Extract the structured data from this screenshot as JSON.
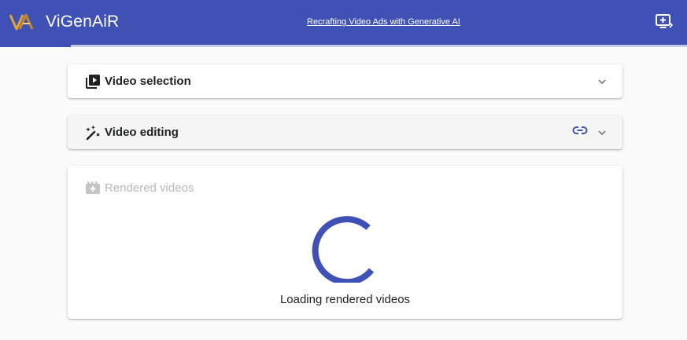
{
  "app": {
    "title": "ViGenAiR",
    "tagline": "Recrafting Video Ads with Generative AI"
  },
  "colors": {
    "primary": "#3f51b5",
    "progress_fill": "#c5cae9",
    "background": "#fafafa",
    "muted_text": "#b8b8b8"
  },
  "progress": {
    "fraction_complete": 0.1
  },
  "panels": {
    "video_selection": {
      "title": "Video selection",
      "icon": "video-library-icon",
      "expanded": false
    },
    "video_editing": {
      "title": "Video editing",
      "icon": "magic-wand-icon",
      "extra_icon": "link-icon",
      "expanded": false
    },
    "rendered_videos": {
      "title": "Rendered videos",
      "icon": "movie-edit-icon",
      "loading_text": "Loading rendered videos"
    }
  },
  "toolbar": {
    "new_window_icon": "add-to-queue-icon"
  }
}
